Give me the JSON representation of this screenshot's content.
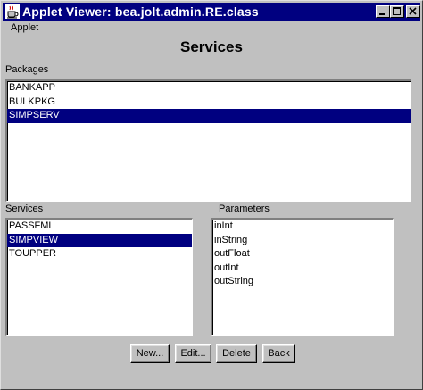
{
  "window": {
    "title": "Applet Viewer: bea.jolt.admin.RE.class",
    "icon": "java-coffee-cup-icon",
    "controls": [
      "minimize-icon",
      "maximize-icon",
      "close-icon"
    ]
  },
  "menubar": {
    "items": [
      {
        "label": "Applet"
      }
    ]
  },
  "page": {
    "title": "Services"
  },
  "packages": {
    "label": "Packages",
    "items": [
      {
        "label": "BANKAPP",
        "selected": false
      },
      {
        "label": "BULKPKG",
        "selected": false
      },
      {
        "label": "SIMPSERV",
        "selected": true
      }
    ]
  },
  "services": {
    "label": "Services",
    "items": [
      {
        "label": "PASSFML",
        "selected": false
      },
      {
        "label": "SIMPVIEW",
        "selected": true
      },
      {
        "label": "TOUPPER",
        "selected": false
      }
    ]
  },
  "parameters": {
    "label": "Parameters",
    "items": [
      {
        "label": "inInt"
      },
      {
        "label": "inString"
      },
      {
        "label": "outFloat"
      },
      {
        "label": "outInt"
      },
      {
        "label": "outString"
      }
    ]
  },
  "buttons": {
    "new": "New...",
    "edit": "Edit...",
    "delete": "Delete",
    "back": "Back"
  },
  "colors": {
    "titlebar": "#000080",
    "selection": "#000080",
    "face": "#c0c0c0"
  }
}
